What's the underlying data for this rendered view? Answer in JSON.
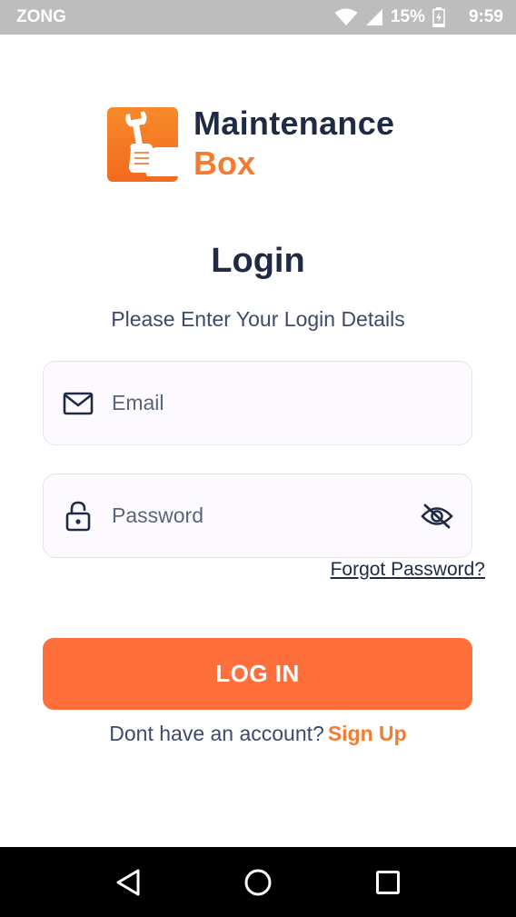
{
  "status_bar": {
    "carrier": "ZONG",
    "battery": "15%",
    "time": "9:59"
  },
  "logo": {
    "line1": "Maintenance",
    "line2": "Box",
    "icon": "wrench-hand-icon"
  },
  "login": {
    "title": "Login",
    "subtitle": "Please Enter Your Login Details"
  },
  "email": {
    "placeholder": "Email",
    "value": "",
    "icon": "mail-icon"
  },
  "password": {
    "placeholder": "Password",
    "value": "",
    "icon": "lock-icon",
    "toggle_icon": "eye-off-icon"
  },
  "forgot_password": "Forgot Password?",
  "login_button": "LOG IN",
  "signup": {
    "prompt": "Dont have an account?",
    "link": "Sign Up"
  },
  "nav": {
    "back_icon": "back-triangle-icon",
    "home_icon": "home-circle-icon",
    "recents_icon": "recents-square-icon"
  },
  "colors": {
    "accent": "#ff6f3c",
    "brand_orange": "#f47b32",
    "text_dark": "#1f2a44",
    "status_bar": "#bdbdbd"
  }
}
